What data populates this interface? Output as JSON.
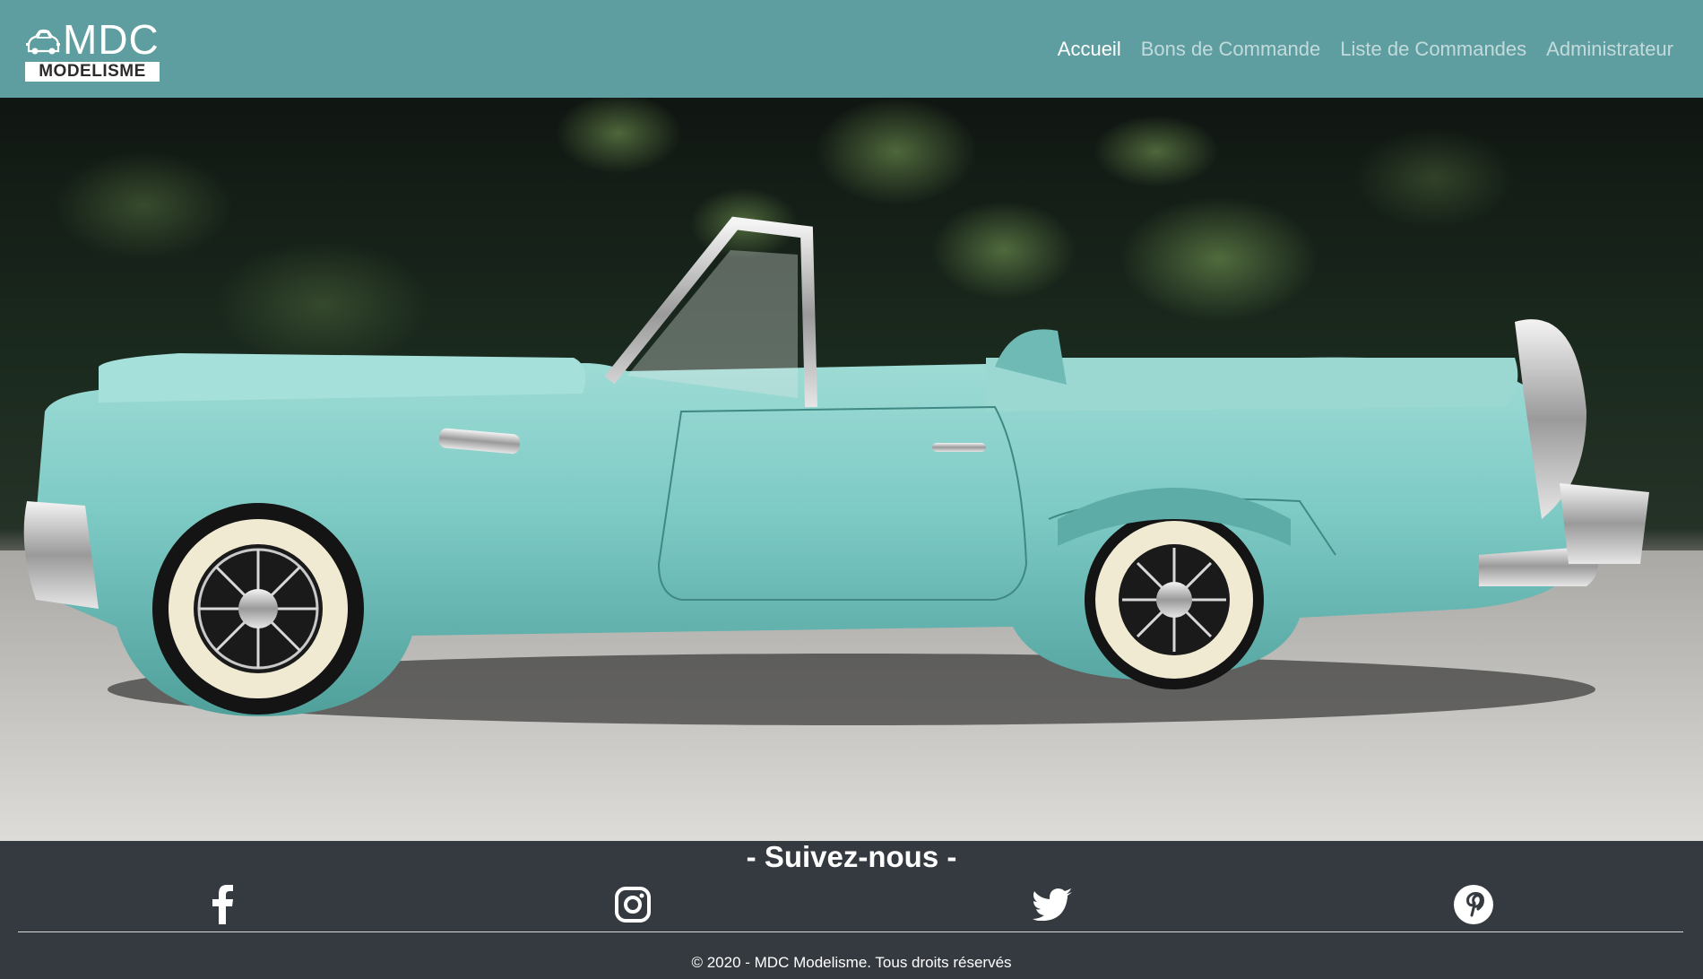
{
  "brand": {
    "title": "MDC",
    "subtitle": "MODELISME",
    "logo_icon": "car-icon"
  },
  "nav": {
    "items": [
      {
        "label": "Accueil",
        "active": true
      },
      {
        "label": "Bons de Commande",
        "active": false
      },
      {
        "label": "Liste de Commandes",
        "active": false
      },
      {
        "label": "Administrateur",
        "active": false
      }
    ]
  },
  "hero": {
    "image": "turquoise-convertible-model-car-photo",
    "car_color": "#7cc9c4"
  },
  "footer": {
    "follow_title": "- Suivez-nous -",
    "social": [
      {
        "name": "facebook-icon"
      },
      {
        "name": "instagram-icon"
      },
      {
        "name": "twitter-icon"
      },
      {
        "name": "pinterest-icon"
      }
    ],
    "copyright": "© 2020 - MDC Modelisme. Tous droits réservés"
  },
  "colors": {
    "navbar": "#5f9ea0",
    "footer": "#343a40",
    "nav_inactive": "rgba(255,255,255,0.62)",
    "nav_active": "#ffffff"
  }
}
